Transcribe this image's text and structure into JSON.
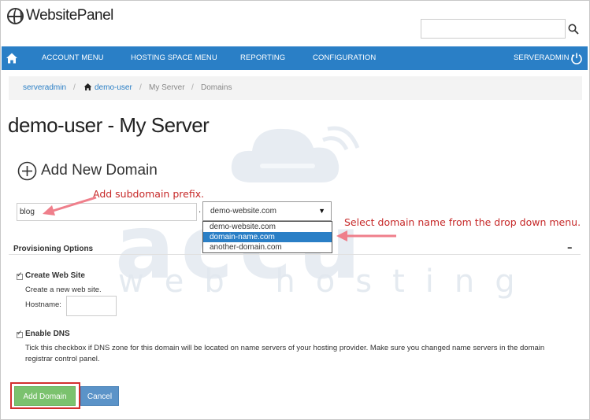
{
  "header": {
    "logo_text": "WebsitePanel",
    "search": {
      "value": "",
      "placeholder": ""
    }
  },
  "nav": {
    "items": [
      {
        "label": "ACCOUNT MENU"
      },
      {
        "label": "HOSTING SPACE MENU"
      },
      {
        "label": "REPORTING"
      },
      {
        "label": "CONFIGURATION"
      }
    ],
    "user_label": "SERVERADMIN |"
  },
  "breadcrumb": {
    "items": [
      "serveradmin",
      "demo-user",
      "My Server",
      "Domains"
    ],
    "separator": "/"
  },
  "page_title": "demo-user - My Server",
  "section_title": "Add New Domain",
  "form": {
    "prefix_value": "blog",
    "dot": ".",
    "domain_selected": "demo-website.com",
    "domain_options": [
      "demo-website.com",
      "domain-name.com",
      "another-domain.com"
    ],
    "highlighted_option": "domain-name.com"
  },
  "annotations": {
    "prefix_hint": "Add subdomain prefix.",
    "dropdown_hint": "Select domain name from the drop down menu."
  },
  "watermark": {
    "main": "accu",
    "sub": "web hosting"
  },
  "provisioning": {
    "title": "Provisioning Options",
    "collapse": "–",
    "web_site": {
      "label": "Create Web Site",
      "description": "Create a new web site.",
      "hostname_label": "Hostname:",
      "hostname_value": ""
    },
    "dns": {
      "label": "Enable DNS",
      "description": "Tick this checkbox if DNS zone for this domain will be located on name servers of your hosting provider. Make sure you changed name servers in the domain registrar control panel."
    }
  },
  "buttons": {
    "add": "Add Domain",
    "cancel": "Cancel"
  },
  "colors": {
    "nav": "#2a7fc6",
    "link": "#2a7fc6",
    "add_button": "#7bc26e",
    "cancel_button": "#5b93c8",
    "annotation": "#c62828"
  }
}
